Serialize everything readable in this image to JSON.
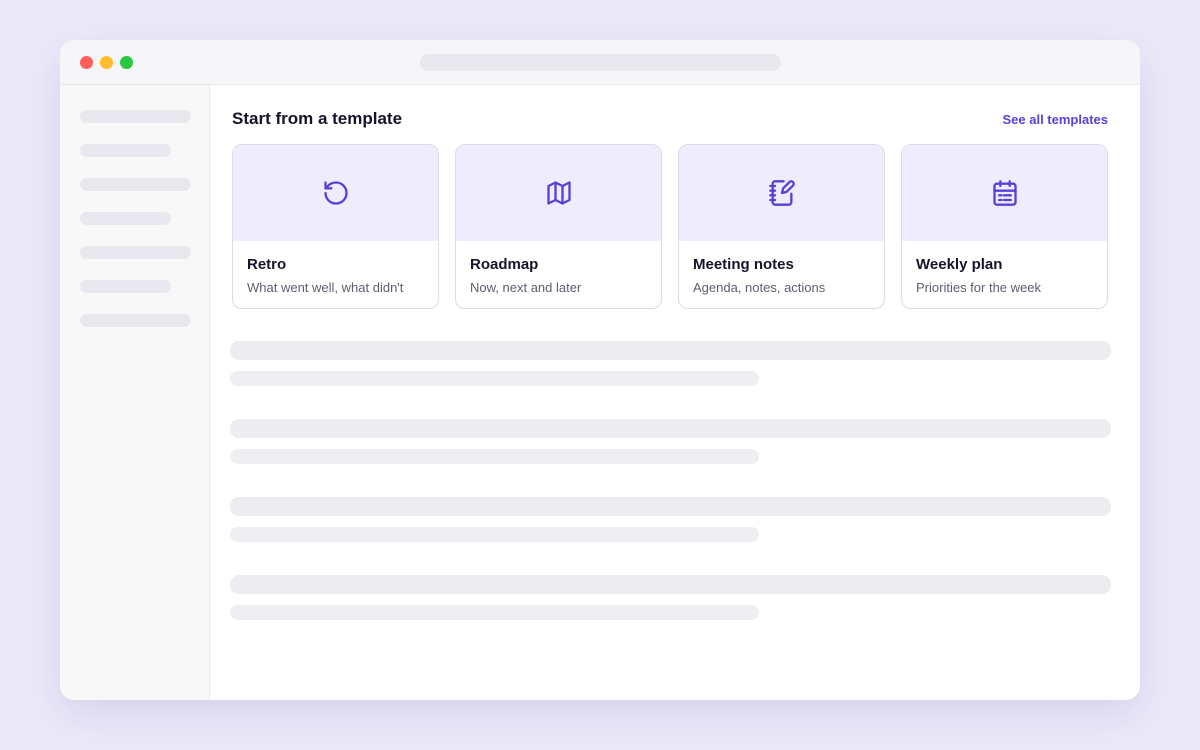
{
  "section": {
    "title": "Start from a template",
    "see_all_label": "See all templates"
  },
  "templates": [
    {
      "title": "Retro",
      "description": "What went well, what didn't",
      "icon": "rotate-ccw-icon"
    },
    {
      "title": "Roadmap",
      "description": "Now, next and later",
      "icon": "map-icon"
    },
    {
      "title": "Meeting notes",
      "description": "Agenda, notes, actions",
      "icon": "notebook-pen-icon"
    },
    {
      "title": "Weekly plan",
      "description": "Priorities for the week",
      "icon": "calendar-icon"
    }
  ],
  "colors": {
    "accent": "#5b3fd9",
    "card_header": "#efedfd",
    "page_background": "#ebe9f9"
  }
}
